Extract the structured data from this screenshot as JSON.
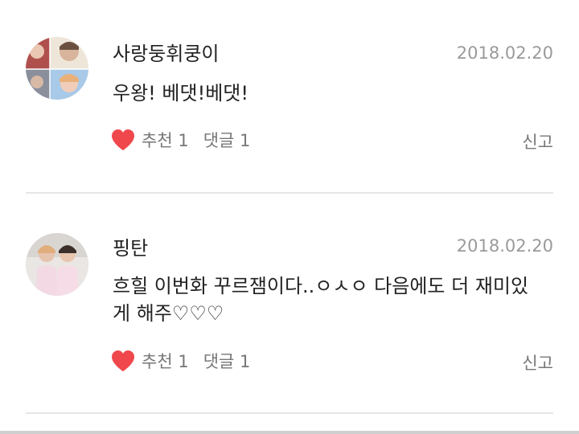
{
  "comments": [
    {
      "author": "사랑둥휘쿵이",
      "date": "2018.02.20",
      "text": "우왕! 베댓!베댓!",
      "like_label": "추천 1",
      "reply_label": "댓글 1",
      "report_label": "신고"
    },
    {
      "author": "핑탄",
      "date": "2018.02.20",
      "text": "흐힐 이번화 꾸르잼이다..ㅇㅅㅇ 다음에도 더 재미있게 해주♡♡♡",
      "like_label": "추천 1",
      "reply_label": "댓글 1",
      "report_label": "신고"
    }
  ],
  "colors": {
    "heart": "#f0474c",
    "text_primary": "#222222",
    "text_secondary": "#777777",
    "date": "#9a9a9a",
    "divider": "#e6e6e6"
  },
  "icons": {
    "like": "heart-icon"
  }
}
